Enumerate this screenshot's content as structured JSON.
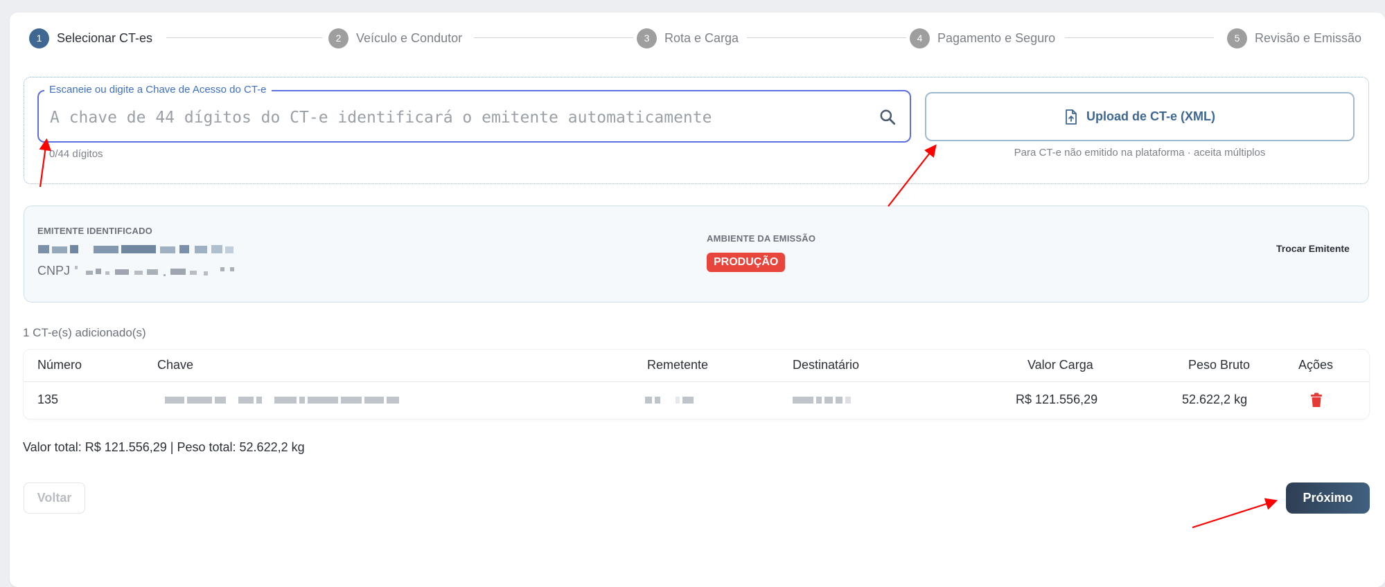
{
  "stepper": {
    "steps": [
      {
        "number": "1",
        "label": "Selecionar CT-es",
        "active": true
      },
      {
        "number": "2",
        "label": "Veículo e Condutor",
        "active": false
      },
      {
        "number": "3",
        "label": "Rota e Carga",
        "active": false
      },
      {
        "number": "4",
        "label": "Pagamento e Seguro",
        "active": false
      },
      {
        "number": "5",
        "label": "Revisão e Emissão",
        "active": false
      }
    ]
  },
  "key_input": {
    "legend": "Escaneie ou digite a Chave de Acesso do CT-e",
    "placeholder": "A chave de 44 dígitos do CT-e identificará o emitente automaticamente",
    "value": "",
    "digit_counter": "0/44 dígitos"
  },
  "upload": {
    "label": "Upload de CT-e (XML)",
    "note": "Para CT-e não emitido na plataforma · aceita múltiplos"
  },
  "emitente": {
    "label": "EMITENTE IDENTIFICADO",
    "cnpj_prefix": "CNPJ",
    "ambiente_label": "AMBIENTE DA EMISSÃO",
    "ambiente_value": "PRODUÇÃO",
    "trocar_label": "Trocar Emitente"
  },
  "cte_count": "1 CT-e(s) adicionado(s)",
  "table": {
    "headers": {
      "numero": "Número",
      "chave": "Chave",
      "remetente": "Remetente",
      "destinatario": "Destinatário",
      "valor_carga": "Valor Carga",
      "peso_bruto": "Peso Bruto",
      "acoes": "Ações"
    },
    "rows": [
      {
        "numero": "135",
        "valor_carga": "R$ 121.556,29",
        "peso_bruto": "52.622,2 kg"
      }
    ]
  },
  "totals": "Valor total: R$ 121.556,29 | Peso total: 52.622,2 kg",
  "buttons": {
    "voltar": "Voltar",
    "proximo": "Próximo"
  },
  "colors": {
    "accent": "#3e6791",
    "badge_red": "#e8453c",
    "trash_red": "#e53935",
    "annotation_arrow": "#ff0000"
  },
  "icons": [
    "search-icon",
    "file-upload-icon",
    "trash-icon"
  ]
}
